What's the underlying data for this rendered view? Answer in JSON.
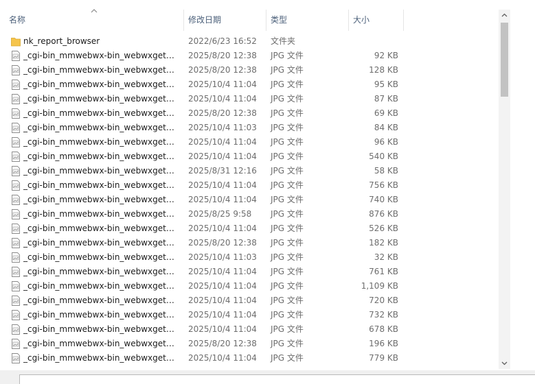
{
  "header": {
    "name": "名称",
    "date": "修改日期",
    "type": "类型",
    "size": "大小"
  },
  "files": [
    {
      "name": "nk_report_browser",
      "date": "2022/6/23 16:52",
      "type": "文件夹",
      "size": "",
      "icon": "folder-icon"
    },
    {
      "name": "_cgi-bin_mmwebwx-bin_webwxgetms...",
      "date": "2025/8/20 12:38",
      "type": "JPG 文件",
      "size": "92 KB",
      "icon": "image-file-icon"
    },
    {
      "name": "_cgi-bin_mmwebwx-bin_webwxgetms...",
      "date": "2025/8/20 12:38",
      "type": "JPG 文件",
      "size": "128 KB",
      "icon": "image-file-icon"
    },
    {
      "name": "_cgi-bin_mmwebwx-bin_webwxgetms...",
      "date": "2025/10/4 11:04",
      "type": "JPG 文件",
      "size": "95 KB",
      "icon": "image-file-icon"
    },
    {
      "name": "_cgi-bin_mmwebwx-bin_webwxgetms...",
      "date": "2025/10/4 11:04",
      "type": "JPG 文件",
      "size": "87 KB",
      "icon": "image-file-icon"
    },
    {
      "name": "_cgi-bin_mmwebwx-bin_webwxgetms...",
      "date": "2025/8/20 12:38",
      "type": "JPG 文件",
      "size": "69 KB",
      "icon": "image-file-icon"
    },
    {
      "name": "_cgi-bin_mmwebwx-bin_webwxgetms...",
      "date": "2025/10/4 11:03",
      "type": "JPG 文件",
      "size": "84 KB",
      "icon": "image-file-icon"
    },
    {
      "name": "_cgi-bin_mmwebwx-bin_webwxgetms...",
      "date": "2025/10/4 11:04",
      "type": "JPG 文件",
      "size": "96 KB",
      "icon": "image-file-icon"
    },
    {
      "name": "_cgi-bin_mmwebwx-bin_webwxgetms...",
      "date": "2025/10/4 11:04",
      "type": "JPG 文件",
      "size": "540 KB",
      "icon": "image-file-icon"
    },
    {
      "name": "_cgi-bin_mmwebwx-bin_webwxgetms...",
      "date": "2025/8/31 12:16",
      "type": "JPG 文件",
      "size": "58 KB",
      "icon": "image-file-icon"
    },
    {
      "name": "_cgi-bin_mmwebwx-bin_webwxgetms...",
      "date": "2025/10/4 11:04",
      "type": "JPG 文件",
      "size": "756 KB",
      "icon": "image-file-icon"
    },
    {
      "name": "_cgi-bin_mmwebwx-bin_webwxgetms...",
      "date": "2025/10/4 11:04",
      "type": "JPG 文件",
      "size": "740 KB",
      "icon": "image-file-icon"
    },
    {
      "name": "_cgi-bin_mmwebwx-bin_webwxgetms...",
      "date": "2025/8/25 9:58",
      "type": "JPG 文件",
      "size": "876 KB",
      "icon": "image-file-icon"
    },
    {
      "name": "_cgi-bin_mmwebwx-bin_webwxgetms...",
      "date": "2025/10/4 11:04",
      "type": "JPG 文件",
      "size": "526 KB",
      "icon": "image-file-icon"
    },
    {
      "name": "_cgi-bin_mmwebwx-bin_webwxgetms...",
      "date": "2025/8/20 12:38",
      "type": "JPG 文件",
      "size": "182 KB",
      "icon": "image-file-icon"
    },
    {
      "name": "_cgi-bin_mmwebwx-bin_webwxgetms...",
      "date": "2025/10/4 11:03",
      "type": "JPG 文件",
      "size": "32 KB",
      "icon": "image-file-icon"
    },
    {
      "name": "_cgi-bin_mmwebwx-bin_webwxgetms...",
      "date": "2025/10/4 11:04",
      "type": "JPG 文件",
      "size": "761 KB",
      "icon": "image-file-icon"
    },
    {
      "name": "_cgi-bin_mmwebwx-bin_webwxgetms...",
      "date": "2025/10/4 11:04",
      "type": "JPG 文件",
      "size": "1,109 KB",
      "icon": "image-file-icon"
    },
    {
      "name": "_cgi-bin_mmwebwx-bin_webwxgetms...",
      "date": "2025/10/4 11:04",
      "type": "JPG 文件",
      "size": "720 KB",
      "icon": "image-file-icon"
    },
    {
      "name": "_cgi-bin_mmwebwx-bin_webwxgetms...",
      "date": "2025/10/4 11:04",
      "type": "JPG 文件",
      "size": "732 KB",
      "icon": "image-file-icon"
    },
    {
      "name": "_cgi-bin_mmwebwx-bin_webwxgetms...",
      "date": "2025/10/4 11:04",
      "type": "JPG 文件",
      "size": "678 KB",
      "icon": "image-file-icon"
    },
    {
      "name": "_cgi-bin_mmwebwx-bin_webwxgetms...",
      "date": "2025/8/20 12:38",
      "type": "JPG 文件",
      "size": "196 KB",
      "icon": "image-file-icon"
    },
    {
      "name": "_cgi-bin_mmwebwx-bin_webwxgetms...",
      "date": "2025/10/4 11:04",
      "type": "JPG 文件",
      "size": "779 KB",
      "icon": "image-file-icon"
    }
  ],
  "colors": {
    "header_text": "#4c607a",
    "folder": "#f5c44b",
    "scroll_thumb": "#c2c2c2"
  }
}
